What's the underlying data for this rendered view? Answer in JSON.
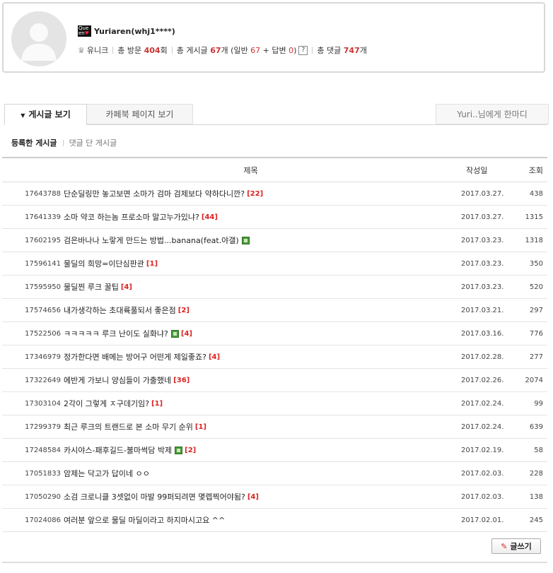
{
  "profile": {
    "badge_top": "Que",
    "badge_bottom": "en",
    "nickname": "Yuriaren(whj1****)",
    "rank_icon": "crown-icon",
    "rank": "유니크",
    "visits_label": "총 방문",
    "visits_count": "404",
    "visits_unit": "회",
    "posts_label": "총 게시글",
    "posts_count": "67",
    "posts_unit": "개 (일반",
    "general_count": "67",
    "plus_reply": "+ 답변",
    "reply_count": "0",
    "close_paren": ")",
    "help": "?",
    "comments_label": "총 댓글",
    "comments_count": "747",
    "comments_unit": "개"
  },
  "tabs": {
    "posts": "게시글 보기",
    "cafebook": "카페북 페이지 보기",
    "message": "Yuri..님에게 한마디"
  },
  "subtabs": {
    "registered": "등록한 게시글",
    "commented": "댓글 단 게시글"
  },
  "table": {
    "headers": {
      "title": "제목",
      "date": "작성일",
      "views": "조회"
    },
    "rows": [
      {
        "no": "17643788",
        "title": "단순딜링만 놓고보면 소마가 검마 검제보다 약하다니깐?",
        "comments": "[22]",
        "image": false,
        "date": "2017.03.27.",
        "views": "438"
      },
      {
        "no": "17641339",
        "title": "소마 약코 하는놈 프로소마 말고누가있냐?",
        "comments": "[44]",
        "image": false,
        "date": "2017.03.27.",
        "views": "1315"
      },
      {
        "no": "17602195",
        "title": "검은바나나 노랗게 만드는 방법...banana(feat.야갤)",
        "comments": "",
        "image": true,
        "date": "2017.03.23.",
        "views": "1318"
      },
      {
        "no": "17596141",
        "title": "물딜의 희망=이단심판관",
        "comments": "[1]",
        "image": false,
        "date": "2017.03.23.",
        "views": "350"
      },
      {
        "no": "17595950",
        "title": "물딜찐 루크 꿀팁",
        "comments": "[4]",
        "image": false,
        "date": "2017.03.23.",
        "views": "520"
      },
      {
        "no": "17574656",
        "title": "내가생각하는 초대륙풀되서 좋은점",
        "comments": "[2]",
        "image": false,
        "date": "2017.03.21.",
        "views": "297"
      },
      {
        "no": "17522506",
        "title": "ㅋㅋㅋㅋㅋ 루크 난이도 실화냐?",
        "comments": "[4]",
        "image": true,
        "date": "2017.03.16.",
        "views": "776"
      },
      {
        "no": "17346979",
        "title": "정가한다면 배메는 방어구 어떤게 제일좋죠?",
        "comments": "[4]",
        "image": false,
        "date": "2017.02.28.",
        "views": "277"
      },
      {
        "no": "17322649",
        "title": "에반게 가보니 양심들이 가출했네",
        "comments": "[36]",
        "image": false,
        "date": "2017.02.26.",
        "views": "2074"
      },
      {
        "no": "17303104",
        "title": "2각이 그렇게 ㅈ구데기임?",
        "comments": "[1]",
        "image": false,
        "date": "2017.02.24.",
        "views": "99"
      },
      {
        "no": "17299379",
        "title": "최근 루크의 트랜드로 본 소마 무기 순위",
        "comments": "[1]",
        "image": false,
        "date": "2017.02.24.",
        "views": "639"
      },
      {
        "no": "17248584",
        "title": "카시야스-패후길드-불마썩담 박제",
        "comments": "[2]",
        "image": true,
        "date": "2017.02.19.",
        "views": "58"
      },
      {
        "no": "17051833",
        "title": "암제는 닥고가 답이네 ㅇㅇ",
        "comments": "",
        "image": false,
        "date": "2017.02.03.",
        "views": "228"
      },
      {
        "no": "17050290",
        "title": "소검 크로니클 3셋없이 마발 99퍼되려면 몇렙찍어야됨?",
        "comments": "[4]",
        "image": false,
        "date": "2017.02.03.",
        "views": "138"
      },
      {
        "no": "17024086",
        "title": "여러분 앞으로 물딜 마딜이라고 하지마시고요 ^^",
        "comments": "",
        "image": false,
        "date": "2017.02.01.",
        "views": "245"
      }
    ]
  },
  "write_button": "글쓰기"
}
